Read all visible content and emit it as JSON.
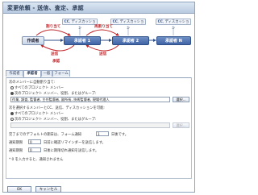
{
  "dialog": {
    "title": "変更依頼 - 送信、査定、承認"
  },
  "workflow": {
    "author_label": "作成者",
    "approvers": [
      "承認者 1",
      "承認者 2",
      "承認者 N"
    ],
    "cc_label": "CC",
    "discussion_label": "ディスカッション",
    "assign_label": "割り当て",
    "reassign_label": "再割り当て",
    "send_label": "送信",
    "approve_label": "承認",
    "colors": {
      "approver": "#3f64a6",
      "accent_red": "#c0282d"
    }
  },
  "tabs": [
    {
      "label": "作成者"
    },
    {
      "label": "承認者"
    },
    {
      "label": "一般"
    },
    {
      "label": "フォーム"
    }
  ],
  "panel": {
    "section1_label": "次のメンバーに自動割り当て:",
    "opt_all_label": "すべてのプロジェクト メンバー",
    "opt_members_label": "次のプロジェクト メンバー、役割、またはグループ:",
    "members_value": "作業, 調査, 監督者, 主任監督者, 副所長, 技術監督者, 現場代理人",
    "select_button": "選択...",
    "section2_label": "次を選択するメンバーとCC、送信、ディスカッションを可能:",
    "opt2_all_label": "すべてのプロジェクト メンバー",
    "opt2_members_label": "次のプロジェクト メンバー、役割、またはグループ:",
    "members2_value": "",
    "select_button2": "選択...",
    "due_label": "完了までのデフォルトの期日は、フォーム通知",
    "due_value": "1",
    "due_suffix": "日後です。",
    "reminder_label": "通知期限",
    "reminder_value": "0",
    "reminder_suffix": "日前に確認リマインダーを送信します。",
    "overdue_label": "通知期限",
    "overdue_value": "0",
    "overdue_suffix": "日後に期限切れ通知を送信します。",
    "note": "* 0 を入力すると、通知されません"
  },
  "buttons": {
    "ok": "OK",
    "cancel": "キャンセル"
  }
}
